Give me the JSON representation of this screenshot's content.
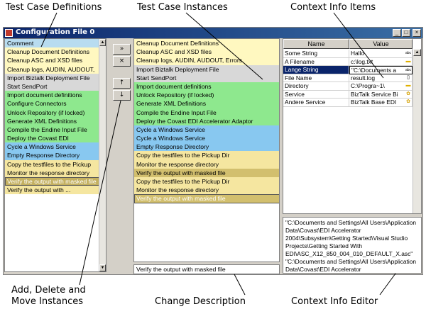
{
  "callouts": {
    "test_case_definitions": "Test Case Definitions",
    "test_case_instances": "Test Case Instances",
    "context_info_items": "Context Info Items",
    "add_delete_move_line1": "Add, Delete and",
    "add_delete_move_line2": "Move Instances",
    "change_description": "Change Description",
    "context_info_editor": "Context Info Editor"
  },
  "window": {
    "title": "Configuration File 0",
    "min_label": "_",
    "max_label": "□",
    "close_label": "×"
  },
  "colors": {
    "yellow": "#fff8c0",
    "gray": "#d8d8d8",
    "green": "#8ee88e",
    "blue": "#88c8f0",
    "sand": "#f5e6a0",
    "selected_definition": "#c4b060",
    "selected_instance": "#d2bf6e",
    "comment": "#b8dcf0",
    "grid_selected": "#0a246a"
  },
  "definitions": [
    {
      "label": "Comment",
      "color": "comment"
    },
    {
      "label": "Cleanup Document Definitions",
      "color": "yellow"
    },
    {
      "label": "Cleanup ASC and XSD files",
      "color": "yellow"
    },
    {
      "label": "Cleanup logs, AUDIN, AUDOUT, ",
      "color": "yellow"
    },
    {
      "label": "Import Biztalk Deployment File",
      "color": "gray"
    },
    {
      "label": "Start SendPort",
      "color": "gray"
    },
    {
      "label": "Import document definitions",
      "color": "green"
    },
    {
      "label": "Configure Connectors",
      "color": "green"
    },
    {
      "label": "Unlock Repository (if locked)",
      "color": "green"
    },
    {
      "label": "Generate XML Definitions",
      "color": "green"
    },
    {
      "label": "Compile the Endine Input File",
      "color": "green"
    },
    {
      "label": "Deploy the Covast EDI",
      "color": "green"
    },
    {
      "label": "Cycle a Windows Service",
      "color": "blue"
    },
    {
      "label": "Empty Response Directory",
      "color": "blue"
    },
    {
      "label": "Copy the testfiles to the Pickup",
      "color": "sand"
    },
    {
      "label": "Monitor the response directory",
      "color": "sand"
    },
    {
      "label": "Verify the output with masked file",
      "color": "selected_definition",
      "selected": true
    },
    {
      "label": "Verify the output with ...",
      "color": "sand"
    }
  ],
  "instances": [
    {
      "label": "Cleanup Document Definitions",
      "color": "yellow"
    },
    {
      "label": "Cleanup ASC and XSD files",
      "color": "yellow"
    },
    {
      "label": "Cleanup logs, AUDIN, AUDOUT, Errors",
      "color": "yellow"
    },
    {
      "label": "Import Biztalk Deployment File",
      "color": "gray"
    },
    {
      "label": "Start SendPort",
      "color": "gray"
    },
    {
      "label": "Import document definitions",
      "color": "green"
    },
    {
      "label": "Unlock Repository (if locked)",
      "color": "green"
    },
    {
      "label": "Generate XML Definitions",
      "color": "green"
    },
    {
      "label": "Compile the Endine Input File",
      "color": "green"
    },
    {
      "label": "Deploy the Covast EDI Accelerator Adaptor",
      "color": "green"
    },
    {
      "label": "Cycle a Windows Service",
      "color": "blue"
    },
    {
      "label": "Cycle a Windows Service",
      "color": "blue"
    },
    {
      "label": "Empty Response Directory",
      "color": "blue"
    },
    {
      "label": "Copy the testfiles to the Pickup Dir",
      "color": "sand"
    },
    {
      "label": "Monitor the response directory",
      "color": "sand"
    },
    {
      "label": "Verify the output with masked file",
      "color": "selected_instance"
    },
    {
      "label": "Copy the testfiles to the Pickup Dir",
      "color": "sand"
    },
    {
      "label": "Monitor the response directory",
      "color": "sand"
    },
    {
      "label": "Verify the output with masked file",
      "color": "selected_instance",
      "selected": true
    }
  ],
  "buttons": {
    "add": "»",
    "delete": "×",
    "move_up": "↑",
    "move_down": "↓"
  },
  "description": "Verify the output with masked file",
  "grid": {
    "col_name": "Name",
    "col_value": "Value",
    "rows": [
      {
        "name": "Some String",
        "value": "Hallo",
        "icon": "abc-icon"
      },
      {
        "name": "A Filename",
        "value": "c:\\log.txt",
        "icon": "folder-icon"
      },
      {
        "name": "Lange String",
        "value": "\"C:\\Documents a",
        "icon": "abc-icon",
        "selected": true
      },
      {
        "name": "File Name",
        "value": "result.log",
        "icon": "file-icon"
      },
      {
        "name": "Directory",
        "value": "C:\\Progra~1\\",
        "icon": "folder-icon"
      },
      {
        "name": "Service",
        "value": "BizTalk  Service Bi",
        "icon": "gear-icon"
      },
      {
        "name": "Andere Service",
        "value": "BizTalk Base EDI",
        "icon": "gear-icon"
      }
    ]
  },
  "editor_text": "\"C:\\Documents and Settings\\All Users\\Application Data\\Covast\\EDI Accelerator 2004\\Subsystem\\Getting Started\\Visual Studio Projects\\Getting Started With EDI\\ASC_X12_850_004_010_DEFAULT_X.asc\" \"C:\\Documents and Settings\\All Users\\Application Data\\Covast\\EDI Accelerator"
}
